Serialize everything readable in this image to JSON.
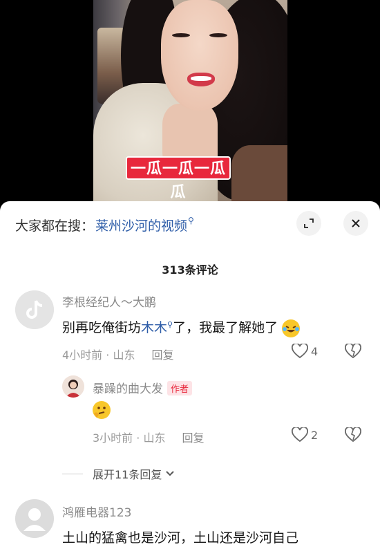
{
  "video": {
    "caption": "一瓜一瓜一瓜瓜"
  },
  "sheet": {
    "search_prefix": "大家都在搜：",
    "search_term": "莱州沙河的视频",
    "comment_count": "313条评论"
  },
  "comments": [
    {
      "username": "李根经纪人～大鹏",
      "text_before": "别再吃俺街坊",
      "text_link": "木木",
      "text_after": "了，我最了解她了",
      "emoji": "laugh-cry-emoji",
      "time": "4小时前 · 山东",
      "reply_label": "回复",
      "likes": "4",
      "replies": [
        {
          "username": "暴躁的曲大发",
          "badge": "作者",
          "emoji": "thinking-emoji",
          "time": "3小时前 · 山东",
          "reply_label": "回复",
          "likes": "2"
        }
      ],
      "expand_label": "展开11条回复"
    },
    {
      "username": "鸿雁电器123",
      "text": "土山的猛禽也是沙河，土山还是沙河自己"
    }
  ],
  "colors": {
    "link": "#2e5da8",
    "badge": "#e8283c"
  }
}
